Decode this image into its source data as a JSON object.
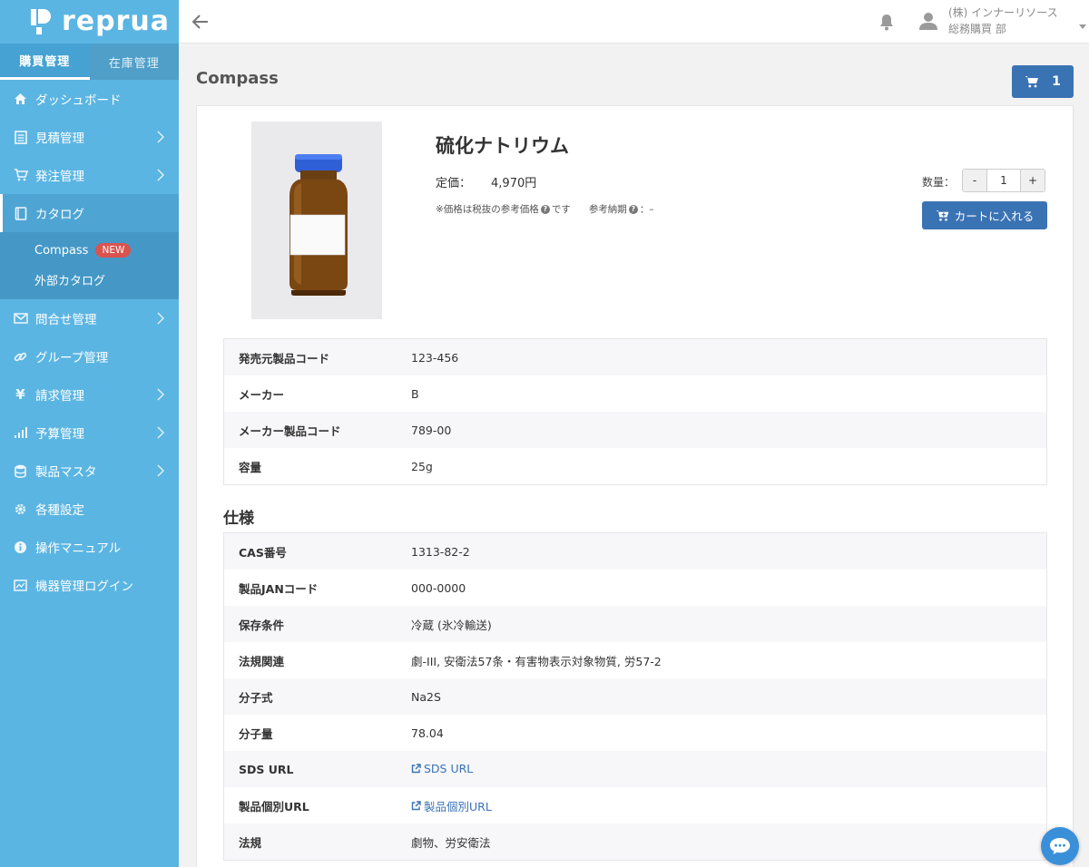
{
  "app": {
    "logo_text": "reprua"
  },
  "sidebar": {
    "tabs": [
      {
        "label": "購買管理",
        "active": true
      },
      {
        "label": "在庫管理",
        "active": false
      }
    ],
    "menu": [
      {
        "label": "ダッシュボード",
        "icon": "home-icon",
        "chevron": false
      },
      {
        "label": "見積管理",
        "icon": "document-icon",
        "chevron": true
      },
      {
        "label": "発注管理",
        "icon": "cart-icon",
        "chevron": true
      },
      {
        "label": "カタログ",
        "icon": "book-icon",
        "chevron": false,
        "active": true
      },
      {
        "label": "問合せ管理",
        "icon": "mail-icon",
        "chevron": true
      },
      {
        "label": "グループ管理",
        "icon": "link-icon",
        "chevron": false
      },
      {
        "label": "請求管理",
        "icon": "yen-icon",
        "chevron": true
      },
      {
        "label": "予算管理",
        "icon": "bar-chart-icon",
        "chevron": true
      },
      {
        "label": "製品マスタ",
        "icon": "database-icon",
        "chevron": true
      },
      {
        "label": "各種設定",
        "icon": "gear-icon",
        "chevron": false
      },
      {
        "label": "操作マニュアル",
        "icon": "info-icon",
        "chevron": false
      },
      {
        "label": "機器管理ログイン",
        "icon": "monitor-icon",
        "chevron": false
      }
    ],
    "submenu": [
      {
        "label": "Compass",
        "badge": "NEW"
      },
      {
        "label": "外部カタログ"
      }
    ]
  },
  "header": {
    "company": "(株) インナーリソース",
    "department": "総務購買 部"
  },
  "page": {
    "title": "Compass",
    "cart_count": "1"
  },
  "product": {
    "name": "硫化ナトリウム",
    "price_label": "定価：",
    "price_value": "4,970円",
    "note_price": "※価格は税抜の参考価格",
    "note_price_suffix": "です",
    "note_delivery": "参考納期",
    "note_delivery_suffix": "：–",
    "qty_label": "数量：",
    "qty_value": "1",
    "qty_minus": "-",
    "qty_plus": "+",
    "add_to_cart": "カートに入れる"
  },
  "basic_info": [
    {
      "key": "発売元製品コード",
      "value": "123-456"
    },
    {
      "key": "メーカー",
      "value": "B"
    },
    {
      "key": "メーカー製品コード",
      "value": "789-00"
    },
    {
      "key": "容量",
      "value": "25g"
    }
  ],
  "spec_title": "仕様",
  "specs": [
    {
      "key": "CAS番号",
      "value": "1313-82-2"
    },
    {
      "key": "製品JANコード",
      "value": "000-0000"
    },
    {
      "key": "保存条件",
      "value": "冷蔵 (氷冷輸送)"
    },
    {
      "key": "法規関連",
      "value": "劇-III, 安衛法57条・有害物表示対象物質, 労57-2"
    },
    {
      "key": "分子式",
      "value": "Na2S"
    },
    {
      "key": "分子量",
      "value": "78.04"
    },
    {
      "key": "SDS URL",
      "value": "SDS URL",
      "link": true
    },
    {
      "key": "製品個別URL",
      "value": "製品個別URL",
      "link": true
    },
    {
      "key": "法規",
      "value": "劇物、労安衛法"
    }
  ],
  "colors": {
    "sidebar": "#5bb5e2",
    "primary": "#3a73b4",
    "badge": "#d9534f"
  }
}
